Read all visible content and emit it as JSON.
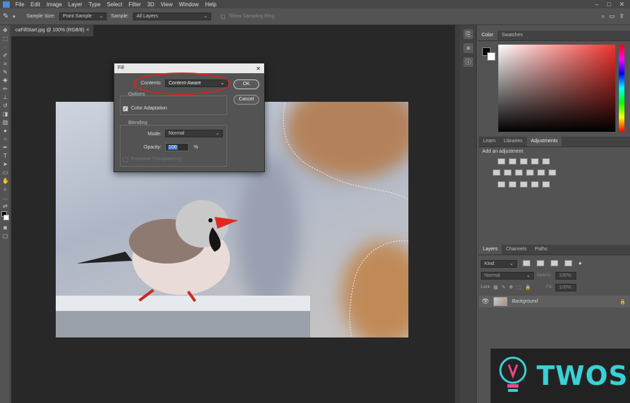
{
  "menu": [
    "File",
    "Edit",
    "Image",
    "Layer",
    "Type",
    "Select",
    "Filter",
    "3D",
    "View",
    "Window",
    "Help"
  ],
  "options": {
    "sample_size_label": "Sample Size:",
    "sample_size_value": "Point Sample",
    "sample_label": "Sample:",
    "sample_value": "All Layers",
    "sampling_ring": "Show Sampling Ring"
  },
  "doc_tab": {
    "title": "caFillStart.jpg @ 100% (RGB/8)",
    "close": "×"
  },
  "color_panel": {
    "tabs": [
      "Color",
      "Swatches"
    ],
    "foreground": "#000000",
    "background": "#ffffff",
    "accent": "#f1322c"
  },
  "adjust_panel": {
    "tabs": [
      "Learn",
      "Libraries",
      "Adjustments"
    ],
    "heading": "Add an adjustment"
  },
  "layers_panel": {
    "tabs": [
      "Layers",
      "Channels",
      "Paths"
    ],
    "filter": "Kind",
    "blend": "Normal",
    "opacity_label": "Opacity:",
    "opacity_value": "100%",
    "lock_label": "Lock:",
    "fill_label": "Fill:",
    "fill_value": "100%",
    "layer_name": "Background"
  },
  "dialog": {
    "title": "Fill",
    "contents_label": "Contents:",
    "contents_value": "Content-Aware",
    "ok": "OK",
    "cancel": "Cancel",
    "options_label": "Options",
    "color_adaptation": "Color Adaptation",
    "blending_label": "Blending",
    "mode_label": "Mode:",
    "mode_value": "Normal",
    "opacity_label": "Opacity:",
    "opacity_value": "100",
    "opacity_unit": "%",
    "preserve": "Preserve Transparency"
  },
  "watermark": {
    "text": "TWOS"
  }
}
